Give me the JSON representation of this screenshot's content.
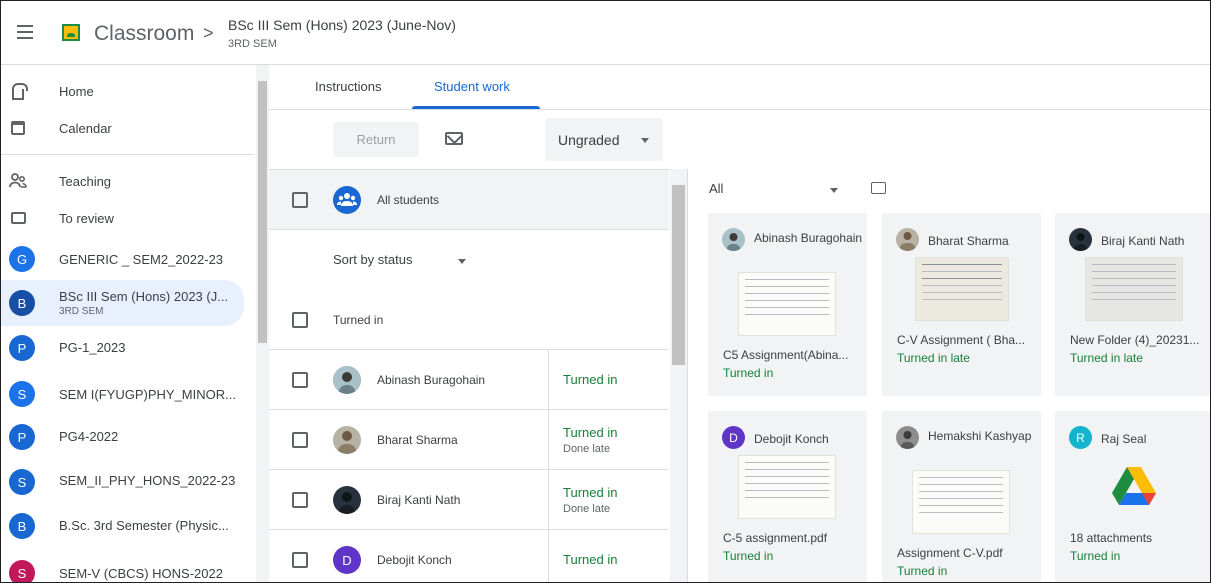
{
  "header": {
    "app_name": "Classroom",
    "breadcrumb_separator": ">",
    "class_title": "BSc III Sem (Hons) 2023 (June-Nov)",
    "class_subtitle": "3RD SEM"
  },
  "sidebar": {
    "home": "Home",
    "calendar": "Calendar",
    "teaching": "Teaching",
    "to_review": "To review",
    "classes": [
      {
        "initial": "G",
        "label": "GENERIC _ SEM2_2022-23",
        "sub": "",
        "color": "#1a73e8"
      },
      {
        "initial": "B",
        "label": "BSc III Sem (Hons) 2023 (J...",
        "sub": "3RD SEM",
        "color": "#174ea6"
      },
      {
        "initial": "P",
        "label": "PG-1_2023",
        "sub": "",
        "color": "#1967d2"
      },
      {
        "initial": "S",
        "label": "SEM I(FYUGP)PHY_MINOR...",
        "sub": "",
        "color": "#1a73e8"
      },
      {
        "initial": "P",
        "label": "PG4-2022",
        "sub": "",
        "color": "#1967d2"
      },
      {
        "initial": "S",
        "label": "SEM_II_PHY_HONS_2022-23",
        "sub": "",
        "color": "#1967d2"
      },
      {
        "initial": "B",
        "label": "B.Sc. 3rd Semester (Physic...",
        "sub": "",
        "color": "#1967d2"
      },
      {
        "initial": "S",
        "label": "SEM-V (CBCS) HONS-2022",
        "sub": "",
        "color": "#c2185b"
      }
    ]
  },
  "tabs": [
    "Instructions",
    "Student work"
  ],
  "toolbar": {
    "return_label": "Return",
    "grade_filter": "Ungraded"
  },
  "list": {
    "all_students": "All students",
    "sort": "Sort by status",
    "group_label": "Turned in",
    "students": [
      {
        "name": "Abinash Buragohain",
        "status": "Turned in",
        "sub": ""
      },
      {
        "name": "Bharat Sharma",
        "status": "Turned in",
        "sub": "Done late"
      },
      {
        "name": "Biraj Kanti Nath",
        "status": "Turned in",
        "sub": "Done late"
      },
      {
        "name": "Debojit Konch",
        "status": "Turned in",
        "sub": "",
        "initial": "D"
      }
    ]
  },
  "work": {
    "filter": "All",
    "cards": [
      {
        "name": "Abinash Buragohain",
        "file": "C5 Assignment(Abina...",
        "status": "Turned in"
      },
      {
        "name": "Bharat Sharma",
        "file": "C-V Assignment ( Bha...",
        "status": "Turned in late"
      },
      {
        "name": "Biraj Kanti Nath",
        "file": "New Folder (4)_20231...",
        "status": "Turned in late"
      },
      {
        "name": "Debojit Konch",
        "initial": "D",
        "file": "C-5 assignment.pdf",
        "status": "Turned in"
      },
      {
        "name": "Hemakshi Kashyap",
        "file": "Assignment C-V.pdf",
        "status": "Turned in"
      },
      {
        "name": "Raj Seal",
        "initial": "R",
        "file": "18 attachments",
        "status": "Turned in"
      }
    ]
  },
  "colors": {
    "accent": "#1967d2",
    "turned_in": "#188038",
    "purple": "#5f35c8",
    "teal": "#12b5cb"
  }
}
